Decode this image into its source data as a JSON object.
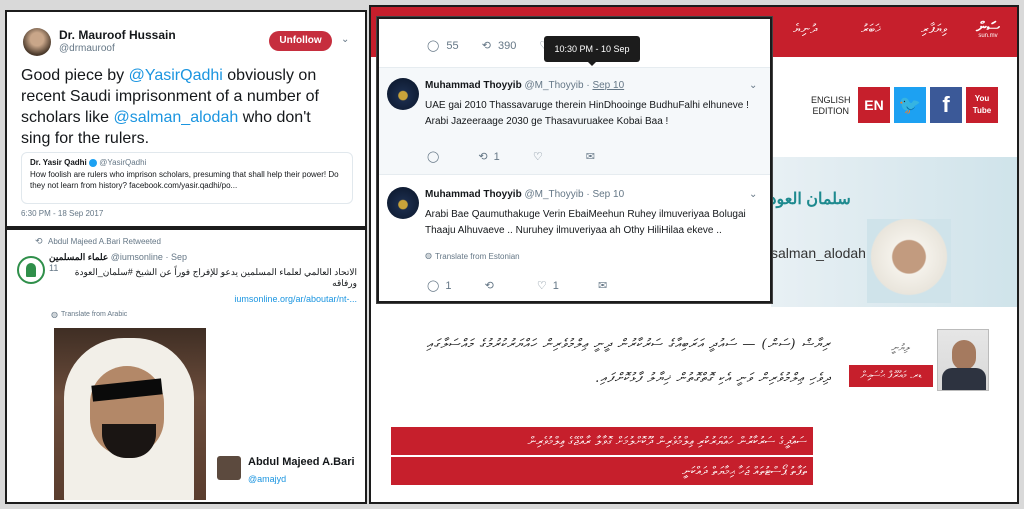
{
  "tweet1": {
    "name": "Dr. Mauroof Hussain",
    "handle": "@drmauroof",
    "follow_label": "Unfollow",
    "text_a": "Good piece by ",
    "mention1": "@YasirQadhi",
    "text_b": " obviously on recent Saudi imprisonment of a number of scholars like ",
    "mention2": "@salman_alodah",
    "text_c": " who don't sing for the rulers.",
    "quote": {
      "name": "Dr. Yasir Qadhi",
      "handle": "@YasirQadhi",
      "text": "How foolish are rulers who imprison scholars, presuming that shall help their power! Do they not learn from history? facebook.com/yasir.qadhi/po..."
    },
    "timestamp": "6:30 PM - 18 Sep 2017"
  },
  "tweet2": {
    "retweet_label": "Abdul Majeed A.Bari Retweeted",
    "account_name": "علماء المسلمين",
    "handle_date": "@iumsonline · Sep 11",
    "text": "الاتحاد العالمي لعلماء المسلمين يدعو للإفراج فوراً عن الشيخ #سلمان_العودة ورفاقه",
    "link": "iumsonline.org/ar/aboutar/nt-...",
    "translate": "Translate from Arabic",
    "card_name": "Abdul Majeed A.Bari",
    "card_handle": "@amajyd"
  },
  "tweet3": {
    "stats": {
      "replies": "55",
      "retweets": "390"
    },
    "tooltip": "10:30 PM - 10 Sep 2017",
    "reply1": {
      "name": "Muhammad Thoyyib",
      "handle": "@M_Thoyyib",
      "date": "Sep 10",
      "text": "UAE gai 2010 Thassavaruge therein HinDhooinge BudhuFalhi elhuneve ! Arabi Jazeeraage 2030 ge Thasavuruakee Kobai Baa !",
      "retweets": "1"
    },
    "reply2": {
      "name": "Muhammad Thoyyib",
      "handle": "@M_Thoyyib",
      "date": "Sep 10",
      "text": "Arabi Bae Qaumuthakuge Verin EbaiMeehun Ruhey ilmuveriyaa Bolugai Thaaju Alhuvaeve .. Nuruhey ilmuveriyaa ah Othy HiliHilaa ekeve ..",
      "translate": "Translate from Estonian",
      "replies": "1",
      "likes": "1"
    }
  },
  "site": {
    "nav": [
      "ދުނިޔެ",
      "ޚަބަރު",
      "ވިޔަފާރި"
    ],
    "logo_sub": "sun.mv",
    "lang_label_1": "ENGLISH",
    "lang_label_2": "EDITION",
    "en_badge": "EN",
    "yt_badge": "You Tube",
    "banner_arabic": "سلمان العودة",
    "banner_handle": "salman_alodah",
    "author_caption": "ލިޔުނީ",
    "author_name": "ޑރ. މައުރޫފް ޙުސައިން",
    "para1": "ރިޔާޟް (ސަން) — ސައުދީ އަރަބިއާގެ ސަރުކާރުން ދީނީ ޢިލްމުވެރިން ހައްޔަރުކުރުމުގެ މައްސަލާގައި",
    "para2": "ދިވެހި ޢިލްމުވެރިން ވަނީ އެކި ގޮތްގޮތުން ޚިޔާލު ފާޅުކޮށްފައި.",
    "highlight1": "ސައުދީގެ ސަރުކާރުން ހައްޔަރުކުރި ޢިލްމުވެރިން ދޫކޮށްލުމަށް ގޮވާލާ ރާއްޖޭގެ ޢިލްމުވެރިން",
    "highlight2": "ތަފާތު ޕޯސްޓުތައް ޖަހާ ޙިމާޔަތް ދައްކަނީ"
  }
}
